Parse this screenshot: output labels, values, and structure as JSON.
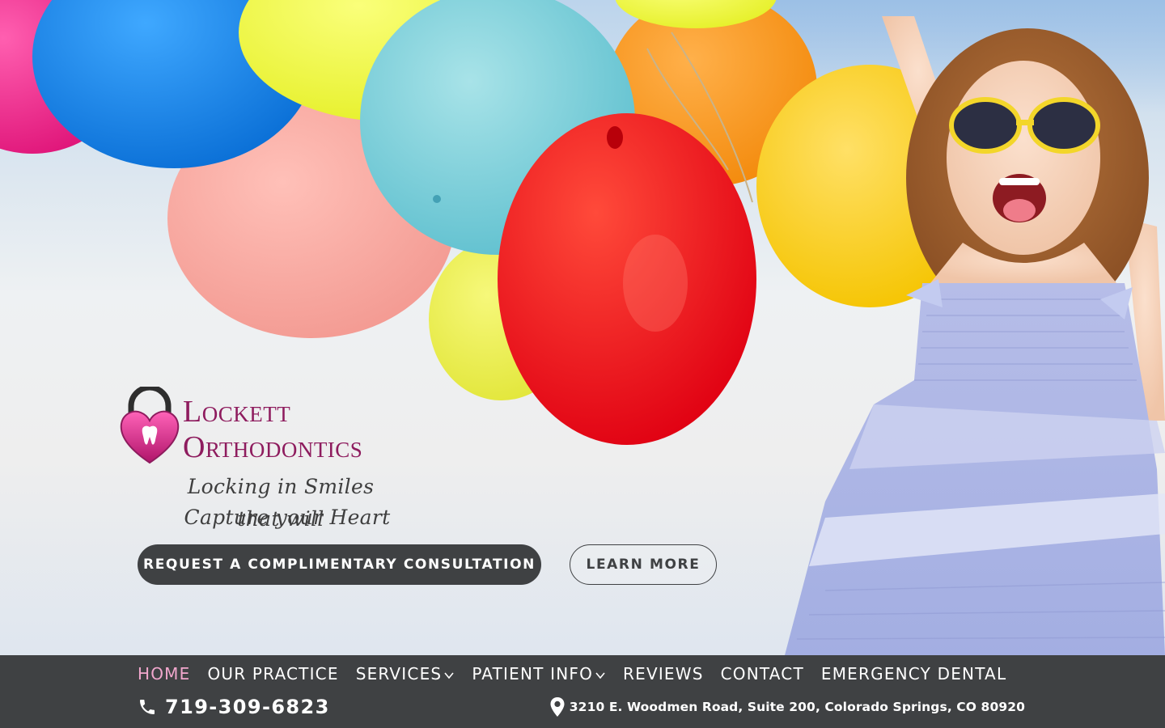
{
  "brand": {
    "name_line1": "Lockett",
    "name_line2": "Orthodontics",
    "tagline_line1": "Locking in Smiles that will",
    "tagline_line2": "Capture your Heart",
    "color": "#8e1c5e"
  },
  "hero": {
    "primary_cta": "REQUEST A COMPLIMENTARY CONSULTATION",
    "secondary_cta": "LEARN MORE"
  },
  "nav": {
    "items": [
      {
        "label": "HOME",
        "active": true,
        "dropdown": false
      },
      {
        "label": "OUR PRACTICE",
        "active": false,
        "dropdown": false
      },
      {
        "label": "SERVICES",
        "active": false,
        "dropdown": true
      },
      {
        "label": "PATIENT INFO",
        "active": false,
        "dropdown": true
      },
      {
        "label": "REVIEWS",
        "active": false,
        "dropdown": false
      },
      {
        "label": "CONTACT",
        "active": false,
        "dropdown": false
      },
      {
        "label": "EMERGENCY DENTAL",
        "active": false,
        "dropdown": false
      }
    ],
    "active_color": "#f1a7cd"
  },
  "contact": {
    "phone": "719-309-6823",
    "phone_icon": "phone-icon",
    "address": "3210 E. Woodmen Road, Suite 200, Colorado Springs, CO 80920",
    "address_icon": "map-pin-icon"
  },
  "colors": {
    "nav_bg": "#3f4143",
    "button_dark": "#3f4143"
  }
}
